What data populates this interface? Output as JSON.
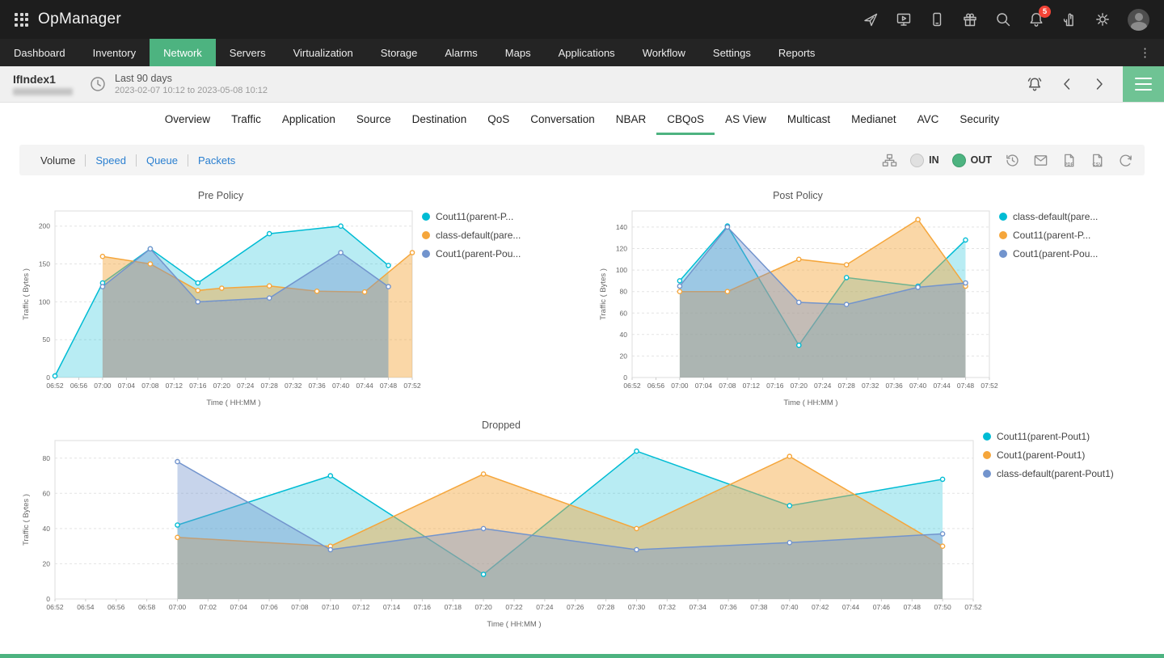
{
  "app": {
    "title": "OpManager"
  },
  "topbar": {
    "notification_count": "5"
  },
  "nav": {
    "items": [
      {
        "label": "Dashboard"
      },
      {
        "label": "Inventory"
      },
      {
        "label": "Network",
        "active": true
      },
      {
        "label": "Servers"
      },
      {
        "label": "Virtualization"
      },
      {
        "label": "Storage"
      },
      {
        "label": "Alarms"
      },
      {
        "label": "Maps"
      },
      {
        "label": "Applications"
      },
      {
        "label": "Workflow"
      },
      {
        "label": "Settings"
      },
      {
        "label": "Reports"
      }
    ]
  },
  "subheader": {
    "title": "IfIndex1",
    "time_range_label": "Last 90 days",
    "time_range_detail": "2023-02-07 10:12 to 2023-05-08 10:12"
  },
  "tabs": {
    "items": [
      {
        "label": "Overview"
      },
      {
        "label": "Traffic"
      },
      {
        "label": "Application"
      },
      {
        "label": "Source"
      },
      {
        "label": "Destination"
      },
      {
        "label": "QoS"
      },
      {
        "label": "Conversation"
      },
      {
        "label": "NBAR"
      },
      {
        "label": "CBQoS",
        "active": true
      },
      {
        "label": "AS View"
      },
      {
        "label": "Multicast"
      },
      {
        "label": "Medianet"
      },
      {
        "label": "AVC"
      },
      {
        "label": "Security"
      }
    ]
  },
  "toolbar": {
    "views": [
      {
        "label": "Volume",
        "active": true
      },
      {
        "label": "Speed"
      },
      {
        "label": "Queue"
      },
      {
        "label": "Packets"
      }
    ],
    "in_label": "IN",
    "out_label": "OUT",
    "pdf_label": "PDF",
    "csv_label": "CSV"
  },
  "icons": {
    "app-grid-icon": "3x3 dot grid",
    "rocket-icon": "launch",
    "screen-play-icon": "demo video",
    "phone-icon": "mobile app",
    "gift-icon": "whats new",
    "search-icon": "magnifier",
    "bell-icon": "notifications",
    "hand-icon": "assistance",
    "gear-icon": "settings",
    "user-avatar": "account",
    "clock-icon": "time period",
    "alert-icon": "alarm bell",
    "chevron-left-icon": "previous",
    "chevron-right-icon": "next",
    "hamburger-icon": "menu",
    "sitemap-icon": "hierarchy",
    "history-icon": "schedule",
    "mail-icon": "email report",
    "pdf-icon": "export pdf",
    "csv-icon": "export csv",
    "reset-icon": "refresh"
  },
  "colors": {
    "accent_green": "#4db380",
    "link_blue": "#2a7fd0",
    "badge_red": "#f44336",
    "series_cyan": "#00bcd4",
    "series_orange": "#f5a63b",
    "series_blue": "#7294cd"
  },
  "chart_data": [
    {
      "type": "area",
      "title": "Pre Policy",
      "xlabel": "Time ( HH:MM )",
      "ylabel": "Traffic ( Bytes )",
      "ylim": [
        0,
        220
      ],
      "yticks": [
        0,
        50,
        100,
        150,
        200
      ],
      "grid": "horizontal-dashed",
      "legend_position": "right",
      "x": [
        "06:52",
        "06:56",
        "07:00",
        "07:04",
        "07:08",
        "07:12",
        "07:16",
        "07:20",
        "07:24",
        "07:28",
        "07:32",
        "07:36",
        "07:40",
        "07:44",
        "07:48",
        "07:52"
      ],
      "series": [
        {
          "name": "Cout11(parent-P...",
          "color": "#00bcd4",
          "fill_opacity": 0.28,
          "points": [
            [
              "06:52",
              2
            ],
            [
              "07:00",
              125
            ],
            [
              "07:08",
              170
            ],
            [
              "07:16",
              125
            ],
            [
              "07:28",
              190
            ],
            [
              "07:40",
              200
            ],
            [
              "07:48",
              148
            ]
          ]
        },
        {
          "name": "class-default(pare...",
          "color": "#f5a63b",
          "fill_opacity": 0.45,
          "points": [
            [
              "07:00",
              160
            ],
            [
              "07:08",
              150
            ],
            [
              "07:16",
              115
            ],
            [
              "07:20",
              118
            ],
            [
              "07:28",
              121
            ],
            [
              "07:36",
              114
            ],
            [
              "07:44",
              113
            ],
            [
              "07:52",
              165
            ]
          ]
        },
        {
          "name": "Cout1(parent-Pou...",
          "color": "#7294cd",
          "fill_opacity": 0.4,
          "points": [
            [
              "07:00",
              120
            ],
            [
              "07:08",
              170
            ],
            [
              "07:16",
              100
            ],
            [
              "07:28",
              105
            ],
            [
              "07:40",
              165
            ],
            [
              "07:48",
              120
            ]
          ]
        }
      ]
    },
    {
      "type": "area",
      "title": "Post Policy",
      "xlabel": "Time ( HH:MM )",
      "ylabel": "Traffic ( Bytes )",
      "ylim": [
        0,
        155
      ],
      "yticks": [
        0,
        20,
        40,
        60,
        80,
        100,
        120,
        140
      ],
      "grid": "horizontal-dashed",
      "legend_position": "right",
      "x": [
        "06:52",
        "06:56",
        "07:00",
        "07:04",
        "07:08",
        "07:12",
        "07:16",
        "07:20",
        "07:24",
        "07:28",
        "07:32",
        "07:36",
        "07:40",
        "07:44",
        "07:48",
        "07:52"
      ],
      "series": [
        {
          "name": "class-default(pare...",
          "color": "#00bcd4",
          "fill_opacity": 0.28,
          "points": [
            [
              "07:00",
              90
            ],
            [
              "07:08",
              141
            ],
            [
              "07:20",
              30
            ],
            [
              "07:28",
              93
            ],
            [
              "07:40",
              85
            ],
            [
              "07:48",
              128
            ]
          ]
        },
        {
          "name": "Cout11(parent-P...",
          "color": "#f5a63b",
          "fill_opacity": 0.45,
          "points": [
            [
              "07:00",
              80
            ],
            [
              "07:08",
              80
            ],
            [
              "07:20",
              110
            ],
            [
              "07:28",
              105
            ],
            [
              "07:40",
              147
            ],
            [
              "07:48",
              85
            ]
          ]
        },
        {
          "name": "Cout1(parent-Pou...",
          "color": "#7294cd",
          "fill_opacity": 0.4,
          "points": [
            [
              "07:00",
              85
            ],
            [
              "07:08",
              140
            ],
            [
              "07:20",
              70
            ],
            [
              "07:28",
              68
            ],
            [
              "07:40",
              84
            ],
            [
              "07:48",
              88
            ]
          ]
        }
      ]
    },
    {
      "type": "area",
      "title": "Dropped",
      "xlabel": "Time ( HH:MM )",
      "ylabel": "Traffic ( Bytes )",
      "ylim": [
        0,
        90
      ],
      "yticks": [
        0,
        20,
        40,
        60,
        80
      ],
      "grid": "horizontal-dashed",
      "legend_position": "right",
      "x": [
        "06:52",
        "06:54",
        "06:56",
        "06:58",
        "07:00",
        "07:02",
        "07:04",
        "07:06",
        "07:08",
        "07:10",
        "07:12",
        "07:14",
        "07:16",
        "07:18",
        "07:20",
        "07:22",
        "07:24",
        "07:26",
        "07:28",
        "07:30",
        "07:32",
        "07:34",
        "07:36",
        "07:38",
        "07:40",
        "07:42",
        "07:44",
        "07:46",
        "07:48",
        "07:50",
        "07:52"
      ],
      "series": [
        {
          "name": "Cout11(parent-Pout1)",
          "color": "#00bcd4",
          "fill_opacity": 0.28,
          "points": [
            [
              "07:00",
              42
            ],
            [
              "07:10",
              70
            ],
            [
              "07:20",
              14
            ],
            [
              "07:30",
              84
            ],
            [
              "07:40",
              53
            ],
            [
              "07:50",
              68
            ]
          ]
        },
        {
          "name": "Cout1(parent-Pout1)",
          "color": "#f5a63b",
          "fill_opacity": 0.45,
          "points": [
            [
              "07:00",
              35
            ],
            [
              "07:10",
              30
            ],
            [
              "07:20",
              71
            ],
            [
              "07:30",
              40
            ],
            [
              "07:40",
              81
            ],
            [
              "07:50",
              30
            ]
          ]
        },
        {
          "name": "class-default(parent-Pout1)",
          "color": "#7294cd",
          "fill_opacity": 0.4,
          "points": [
            [
              "07:00",
              78
            ],
            [
              "07:10",
              28
            ],
            [
              "07:20",
              40
            ],
            [
              "07:30",
              28
            ],
            [
              "07:40",
              32
            ],
            [
              "07:50",
              37
            ]
          ]
        }
      ]
    }
  ]
}
